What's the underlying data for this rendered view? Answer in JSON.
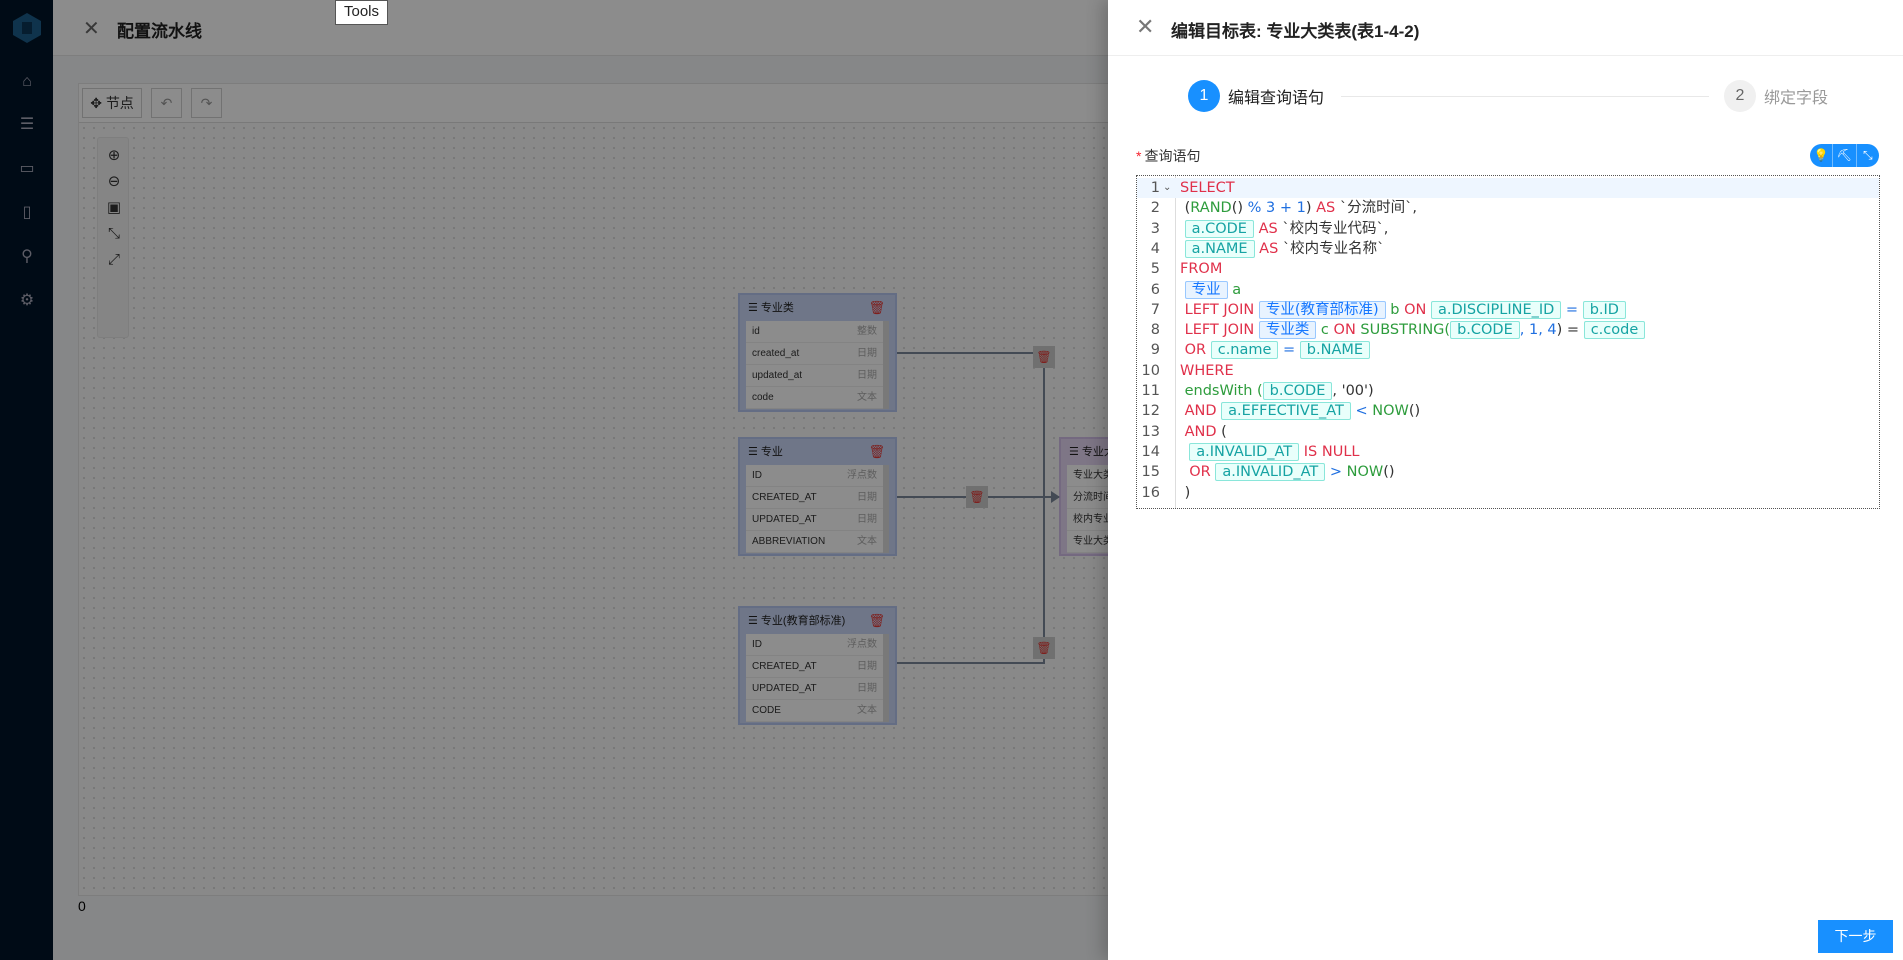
{
  "sidebar": {
    "icons": [
      "home-icon",
      "database-icon",
      "dashboard-icon",
      "report-icon",
      "search-icon",
      "settings-icon"
    ]
  },
  "main": {
    "title": "配置流水线",
    "toolbar": {
      "node_label": "节点",
      "undo": "↶",
      "redo": "↷"
    },
    "zoom_tools": [
      "⊕",
      "⊖",
      "▣",
      "⤡",
      "⤢"
    ],
    "footer_value": "0",
    "tooltip": "Tools",
    "nodes": [
      {
        "title": "专业类",
        "fields": [
          [
            "id",
            "整数"
          ],
          [
            "created_at",
            "日期"
          ],
          [
            "updated_at",
            "日期"
          ],
          [
            "code",
            "文本"
          ]
        ]
      },
      {
        "title": "专业",
        "fields": [
          [
            "ID",
            "浮点数"
          ],
          [
            "CREATED_AT",
            "日期"
          ],
          [
            "UPDATED_AT",
            "日期"
          ],
          [
            "ABBREVIATION",
            "文本"
          ]
        ]
      },
      {
        "title": "专业(教育部标准)",
        "fields": [
          [
            "ID",
            "浮点数"
          ],
          [
            "CREATED_AT",
            "日期"
          ],
          [
            "UPDATED_AT",
            "日期"
          ],
          [
            "CODE",
            "文本"
          ]
        ]
      },
      {
        "title": "专业大类表",
        "fields": [
          [
            "专业大类",
            ""
          ],
          [
            "分流时间",
            ""
          ],
          [
            "校内专业代码",
            ""
          ],
          [
            "专业大类",
            ""
          ]
        ]
      }
    ]
  },
  "drawer": {
    "title": "编辑目标表: 专业大类表(表1-4-2)",
    "steps": [
      {
        "num": "1",
        "label": "编辑查询语句",
        "status": "active"
      },
      {
        "num": "2",
        "label": "绑定字段",
        "status": "wait"
      }
    ],
    "field_label": "查询语句",
    "required_mark": "*",
    "editor_tools": [
      "bulb-icon",
      "format-brush-icon",
      "collapse-icon"
    ],
    "next_button": "下一步",
    "accent": "#1890ff",
    "code_lines": [
      [
        [
          "SELECT",
          "kw"
        ]
      ],
      [
        [
          " (",
          "pl"
        ],
        [
          "RAND",
          "fn"
        ],
        [
          "()",
          "pl"
        ],
        [
          " % 3 + 1",
          "num"
        ],
        [
          ")",
          "pl"
        ],
        [
          " AS ",
          "kw"
        ],
        [
          "`分流时间`,",
          "pl"
        ]
      ],
      [
        [
          " ",
          "pl"
        ],
        [
          "a.CODE",
          "col"
        ],
        [
          " AS ",
          "kw"
        ],
        [
          "`校内专业代码`,",
          "pl"
        ]
      ],
      [
        [
          " ",
          "pl"
        ],
        [
          "a.NAME",
          "col"
        ],
        [
          " AS ",
          "kw"
        ],
        [
          "`校内专业名称`",
          "pl"
        ]
      ],
      [
        [
          "FROM",
          "kw"
        ]
      ],
      [
        [
          " ",
          "pl"
        ],
        [
          "专业",
          "tbl"
        ],
        [
          " a",
          "al"
        ]
      ],
      [
        [
          " LEFT JOIN ",
          "kw"
        ],
        [
          "专业(教育部标准)",
          "tbl"
        ],
        [
          " b ",
          "al"
        ],
        [
          "ON ",
          "kw"
        ],
        [
          "a.DISCIPLINE_ID",
          "col"
        ],
        [
          " = ",
          "num"
        ],
        [
          "b.ID",
          "col"
        ]
      ],
      [
        [
          " LEFT JOIN ",
          "kw"
        ],
        [
          "专业类",
          "tbl"
        ],
        [
          " c ",
          "al"
        ],
        [
          "ON ",
          "kw"
        ],
        [
          "SUBSTRING(",
          "fn"
        ],
        [
          "b.CODE",
          "col"
        ],
        [
          ", 1, 4",
          "num"
        ],
        [
          ") = ",
          "pl"
        ],
        [
          "c.code",
          "col"
        ]
      ],
      [
        [
          " OR ",
          "kw"
        ],
        [
          "c.name",
          "col"
        ],
        [
          " = ",
          "num"
        ],
        [
          "b.NAME",
          "col"
        ]
      ],
      [
        [
          "WHERE",
          "kw"
        ]
      ],
      [
        [
          " endsWith (",
          "fn"
        ],
        [
          "b.CODE",
          "col"
        ],
        [
          ", '00')",
          "pl"
        ]
      ],
      [
        [
          " AND ",
          "kw"
        ],
        [
          "a.EFFECTIVE_AT",
          "col"
        ],
        [
          " < ",
          "num"
        ],
        [
          "NOW",
          "fn"
        ],
        [
          "()",
          "pl"
        ]
      ],
      [
        [
          " AND ",
          "kw"
        ],
        [
          "(",
          "pl"
        ]
      ],
      [
        [
          "  ",
          "pl"
        ],
        [
          "a.INVALID_AT",
          "col"
        ],
        [
          " IS NULL",
          "kw"
        ]
      ],
      [
        [
          "  OR ",
          "kw"
        ],
        [
          "a.INVALID_AT",
          "col"
        ],
        [
          " > ",
          "num"
        ],
        [
          "NOW",
          "fn"
        ],
        [
          "()",
          "pl"
        ]
      ],
      [
        [
          " )",
          "pl"
        ]
      ]
    ]
  }
}
